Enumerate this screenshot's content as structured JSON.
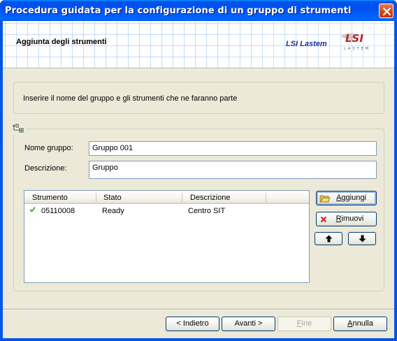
{
  "window": {
    "title": "Procedura guidata per la configurazione di un gruppo di strumenti"
  },
  "header": {
    "title": "Aggiunta degli strumenti",
    "brand_text": "LSI Lastem",
    "logo_text": "LSI",
    "logo_subtext": "LASTEM"
  },
  "intro": {
    "text": "Inserire il nome del gruppo e gli strumenti che ne faranno parte"
  },
  "form": {
    "group_name_label": "Nome gruppo:",
    "group_name_value": "Gruppo 001",
    "description_label": "Descrizione:",
    "description_value": "Gruppo"
  },
  "instruments": {
    "columns": [
      "Strumento",
      "Stato",
      "Descrizione"
    ],
    "rows": [
      {
        "strumento": "05110008",
        "stato": "Ready",
        "descrizione": "Centro SIT",
        "checked": true
      }
    ]
  },
  "side_buttons": {
    "add": {
      "label_u": "A",
      "label_rest": "ggiungi"
    },
    "remove": {
      "label_u": "R",
      "label_rest": "imuovi"
    },
    "up_icon": "arrow-up-icon",
    "down_icon": "arrow-down-icon"
  },
  "footer": {
    "back": "< Indietro",
    "next": "Avanti >",
    "finish_u": "F",
    "finish_rest": "ine",
    "cancel_u": "A",
    "cancel_rest": "nnulla"
  },
  "colors": {
    "titlebar": "#0055ea",
    "brand": "#1b2fa0",
    "logo_red": "#c0202a",
    "check": "#3a9a2a"
  }
}
